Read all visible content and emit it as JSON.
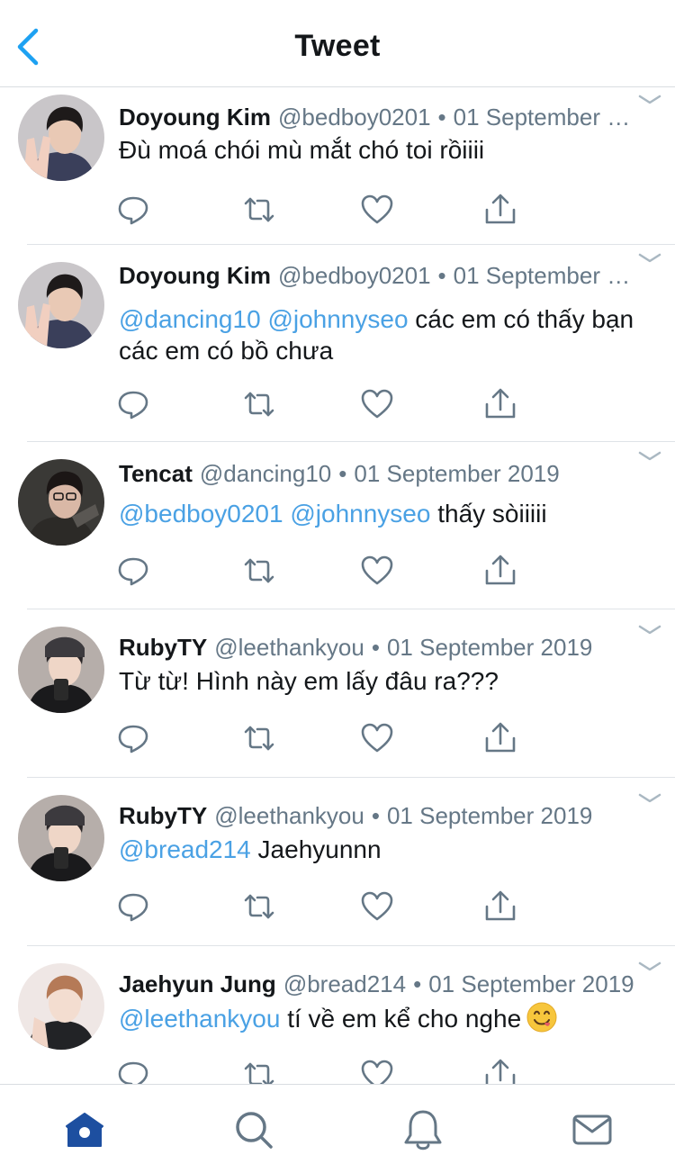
{
  "header": {
    "title": "Tweet",
    "back_icon": "chevron-left-icon"
  },
  "tweets": [
    {
      "name": "Doyoung Kim",
      "handle": "@bedboy0201",
      "date": "01 September 2…",
      "segments": [
        {
          "t": "Đù moá chói mù mắt chó toi rồiiii"
        }
      ]
    },
    {
      "name": "Doyoung Kim",
      "handle": "@bedboy0201",
      "date": "01 September 2…",
      "segments": [
        {
          "t": "@dancing10",
          "m": true
        },
        {
          "t": " "
        },
        {
          "t": "@johnnyseo",
          "m": true
        },
        {
          "t": " các em có thấy bạn các em có bồ chưa"
        }
      ]
    },
    {
      "name": "Tencat",
      "handle": "@dancing10",
      "date": "01 September 2019",
      "segments": [
        {
          "t": "@bedboy0201",
          "m": true
        },
        {
          "t": " "
        },
        {
          "t": "@johnnyseo",
          "m": true
        },
        {
          "t": " thấy sòiiiii"
        }
      ]
    },
    {
      "name": "RubyTY",
      "handle": "@leethankyou",
      "date": "01 September 2019",
      "segments": [
        {
          "t": "Từ từ! Hình này em lấy đâu ra???"
        }
      ]
    },
    {
      "name": "RubyTY",
      "handle": "@leethankyou",
      "date": "01 September 2019",
      "segments": [
        {
          "t": "@bread214",
          "m": true
        },
        {
          "t": " Jaehyunnn"
        }
      ]
    },
    {
      "name": "Jaehyun Jung",
      "handle": "@bread214",
      "date": "01 September 2019",
      "segments": [
        {
          "t": "@leethankyou",
          "m": true
        },
        {
          "t": " tí về em kể cho nghe"
        }
      ],
      "emoji": "yum-face-emoji"
    }
  ],
  "separator": "•",
  "tabbar": {
    "items": [
      "home-icon",
      "search-icon",
      "notifications-bell-icon",
      "messages-envelope-icon"
    ],
    "active": "home-icon"
  },
  "colors": {
    "accent": "#1da1f2",
    "mention": "#4aa1e4",
    "text": "#14171a",
    "meta": "#657786",
    "icon": "#657786"
  }
}
